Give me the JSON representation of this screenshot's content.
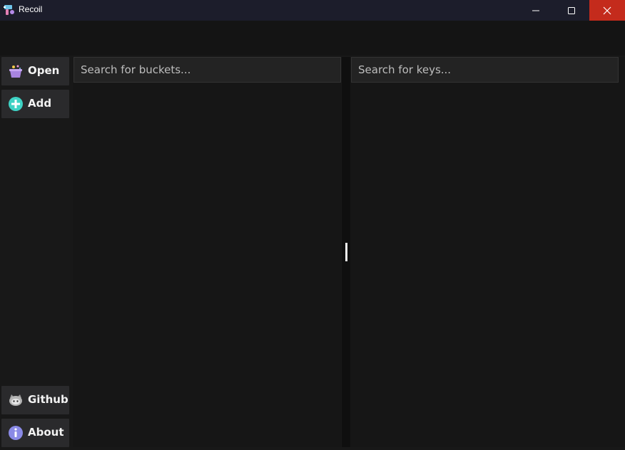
{
  "window": {
    "title": "Recoil",
    "controls": {
      "minimize_icon": "minimize-icon",
      "maximize_icon": "maximize-icon",
      "close_icon": "close-icon",
      "close_color": "#c42b1c"
    }
  },
  "sidebar": {
    "top_items": [
      {
        "label": "Open",
        "icon": "open-box-icon"
      },
      {
        "label": "Add",
        "icon": "plus-circle-icon"
      }
    ],
    "bottom_items": [
      {
        "label": "Github",
        "icon": "github-icon"
      },
      {
        "label": "About",
        "icon": "info-icon"
      }
    ]
  },
  "buckets": {
    "search_placeholder": "Search for buckets...",
    "search_value": ""
  },
  "keys": {
    "search_placeholder": "Search for keys...",
    "search_value": ""
  },
  "colors": {
    "background": "#181818",
    "titlebar": "#1c1d2b",
    "button": "#2a2a2c",
    "accent_add": "#3ed2c4",
    "accent_about": "#8a8ae6"
  }
}
